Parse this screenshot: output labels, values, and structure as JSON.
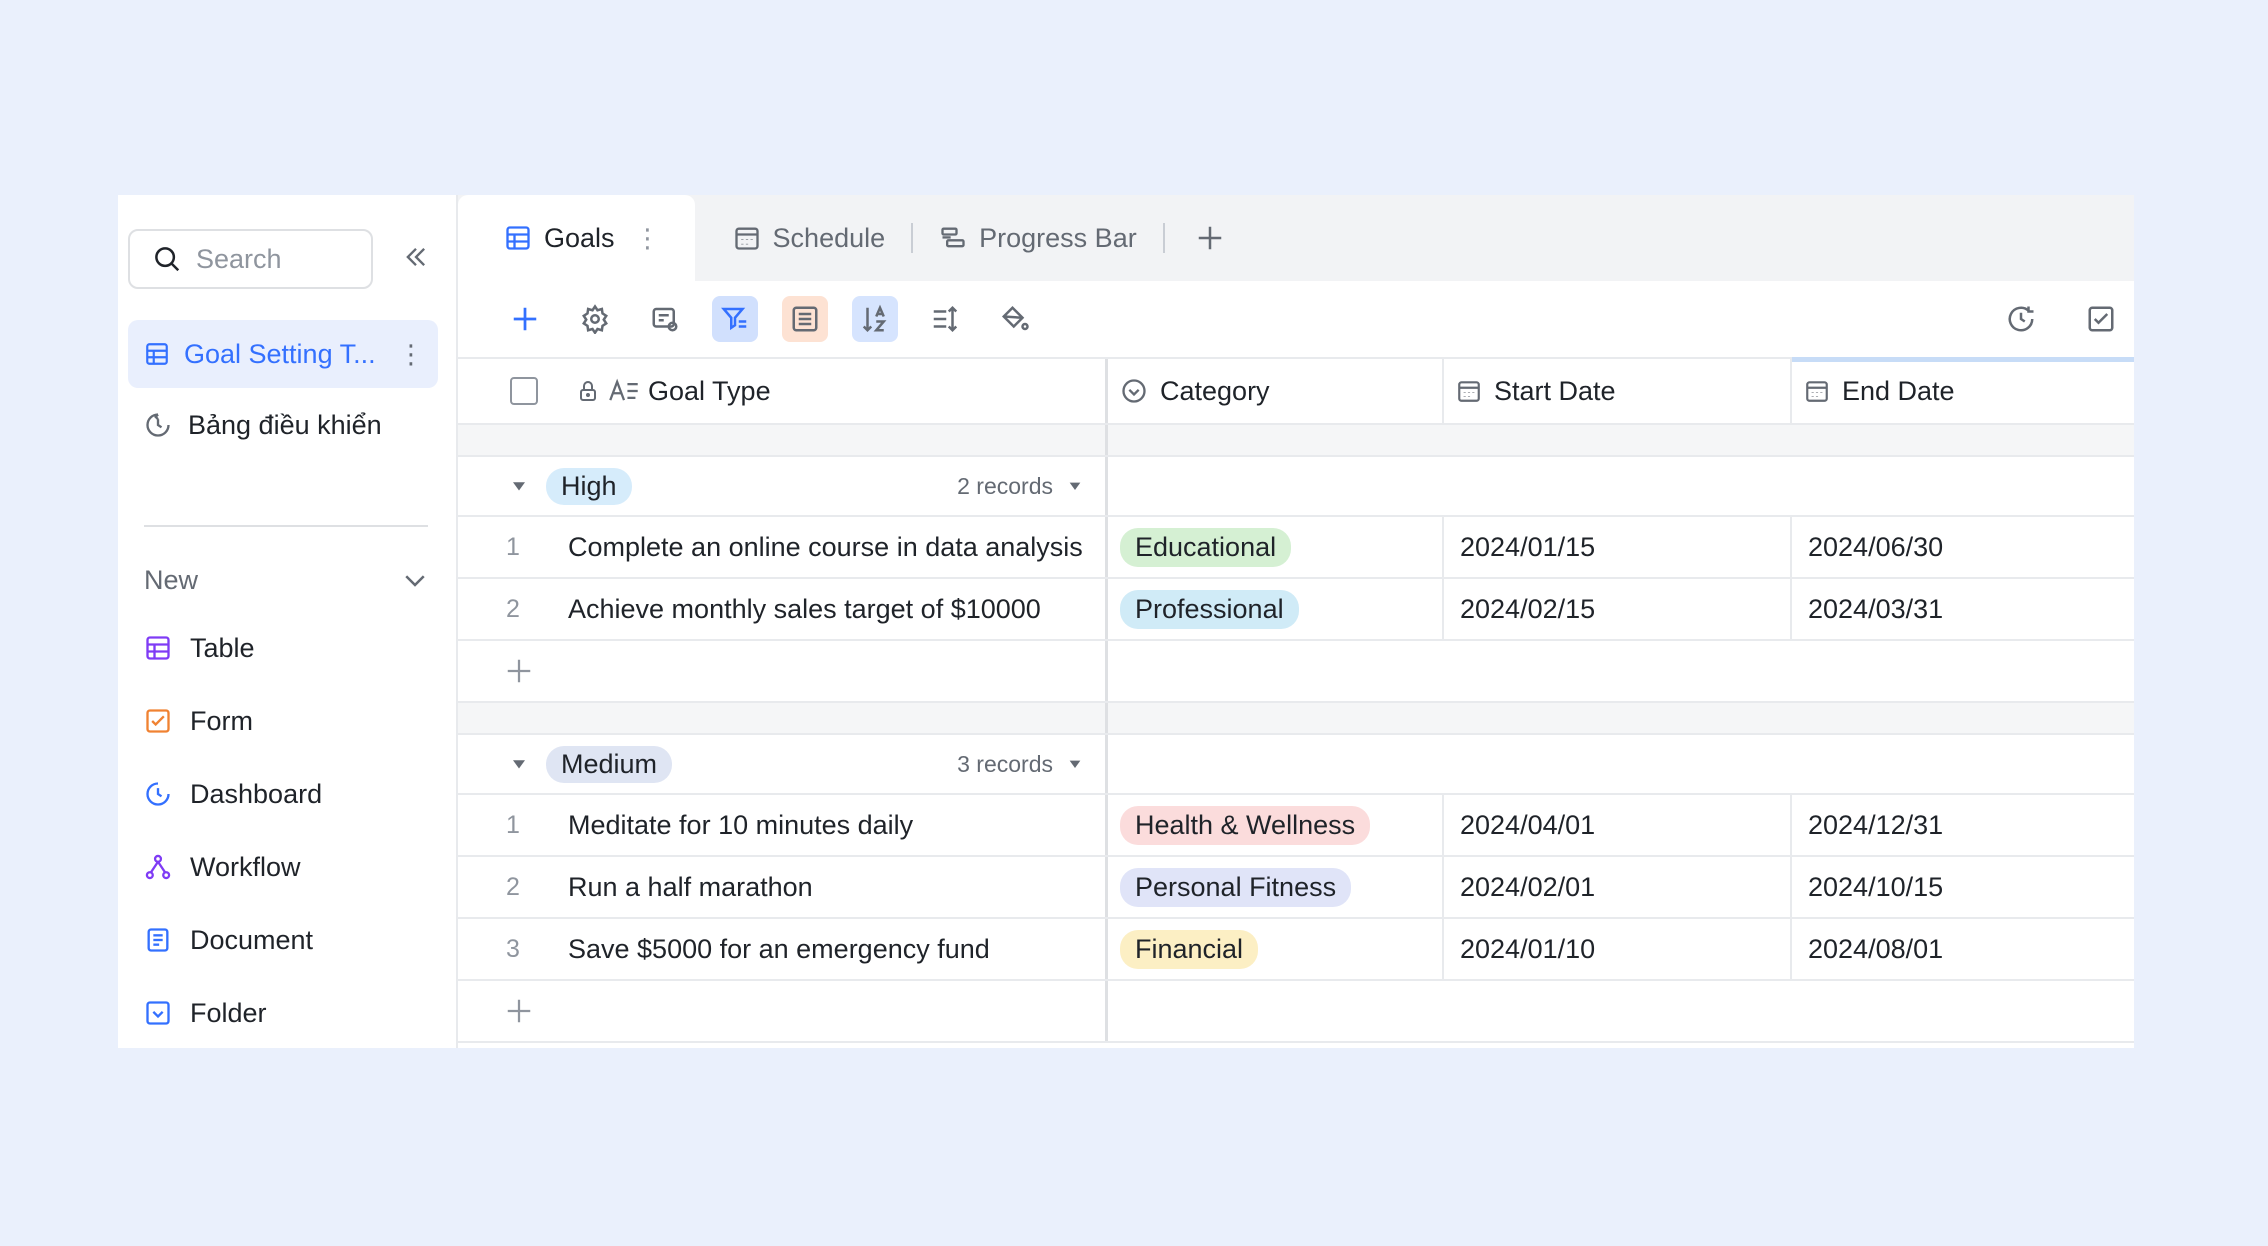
{
  "sidebar": {
    "search_placeholder": "Search",
    "active_item": "Goal Setting T...",
    "items": [
      {
        "label": "Bảng điều khiển"
      }
    ],
    "new_label": "New",
    "new_items": [
      {
        "label": "Table"
      },
      {
        "label": "Form"
      },
      {
        "label": "Dashboard"
      },
      {
        "label": "Workflow"
      },
      {
        "label": "Document"
      },
      {
        "label": "Folder"
      }
    ]
  },
  "tabs": [
    {
      "label": "Goals"
    },
    {
      "label": "Schedule"
    },
    {
      "label": "Progress Bar"
    }
  ],
  "columns": {
    "goal_type": "Goal Type",
    "category": "Category",
    "start_date": "Start Date",
    "end_date": "End Date"
  },
  "groups": [
    {
      "name": "High",
      "count": "2 records",
      "color": "#d6ecfb",
      "rows": [
        {
          "idx": "1",
          "goal": "Complete an online course in data analysis",
          "category": "Educational",
          "cat_color": "#d5f0d3",
          "start": "2024/01/15",
          "end": "2024/06/30"
        },
        {
          "idx": "2",
          "goal": "Achieve monthly sales target of $10000",
          "category": "Professional",
          "cat_color": "#d0ebf7",
          "start": "2024/02/15",
          "end": "2024/03/31"
        }
      ]
    },
    {
      "name": "Medium",
      "count": "3 records",
      "color": "#dfe5f3",
      "rows": [
        {
          "idx": "1",
          "goal": "Meditate for 10 minutes daily",
          "category": "Health & Wellness",
          "cat_color": "#fbdcdc",
          "start": "2024/04/01",
          "end": "2024/12/31"
        },
        {
          "idx": "2",
          "goal": "Run a half marathon",
          "category": "Personal Fitness",
          "cat_color": "#e0e4f8",
          "start": "2024/02/01",
          "end": "2024/10/15"
        },
        {
          "idx": "3",
          "goal": "Save $5000 for an emergency fund",
          "category": "Financial",
          "cat_color": "#fcefc4",
          "start": "2024/01/10",
          "end": "2024/08/01"
        }
      ]
    }
  ],
  "colors": {
    "accent": "#3370ff",
    "bg": "#eaf0fc"
  }
}
